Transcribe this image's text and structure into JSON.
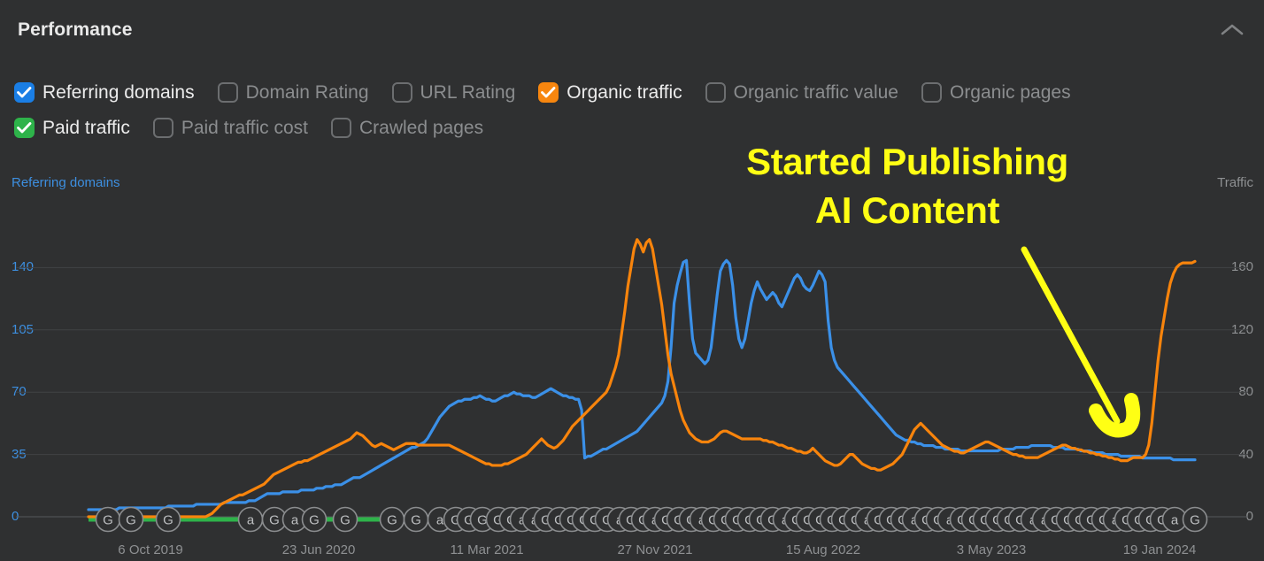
{
  "panel": {
    "title": "Performance",
    "collapse_icon": "chevron-up-icon"
  },
  "metrics": {
    "rows": [
      [
        {
          "label": "Referring domains",
          "checked": true,
          "color": "#1a7ee5"
        },
        {
          "label": "Domain Rating",
          "checked": false,
          "color": "#6c6e70"
        },
        {
          "label": "URL Rating",
          "checked": false,
          "color": "#6c6e70"
        },
        {
          "label": "Organic traffic",
          "checked": true,
          "color": "#f7860f"
        },
        {
          "label": "Organic traffic value",
          "checked": false,
          "color": "#6c6e70"
        },
        {
          "label": "Organic pages",
          "checked": false,
          "color": "#6c6e70"
        }
      ],
      [
        {
          "label": "Paid traffic",
          "checked": true,
          "color": "#2eb34a"
        },
        {
          "label": "Paid traffic cost",
          "checked": false,
          "color": "#6c6e70"
        },
        {
          "label": "Crawled pages",
          "checked": false,
          "color": "#6c6e70"
        }
      ]
    ]
  },
  "annotation": {
    "line1": "Started Publishing",
    "line2": "AI Content",
    "color": "#ffff14",
    "arrow_color": "#ffff14"
  },
  "chart_data": {
    "type": "line",
    "title": "Performance",
    "grid": true,
    "legend_position": "top",
    "xlabel": "",
    "x_ticks": [
      "6 Oct 2019",
      "23 Jun 2020",
      "11 Mar 2021",
      "27 Nov 2021",
      "15 Aug 2022",
      "3 May 2023",
      "19 Jan 2024"
    ],
    "axes": {
      "left": {
        "label": "Referring domains",
        "ticks": [
          140,
          105,
          70,
          35,
          0
        ],
        "range": [
          0,
          175
        ],
        "color": "#3d8fe0"
      },
      "right": {
        "label": "Traffic",
        "ticks": [
          160,
          120,
          80,
          40,
          0
        ],
        "range": [
          0,
          200
        ],
        "color": "#8e9092"
      }
    },
    "series": [
      {
        "name": "Referring domains",
        "color": "#3b90e8",
        "axis": "left",
        "values": [
          4,
          4,
          4,
          4,
          4,
          4,
          4,
          4,
          4,
          4,
          5,
          5,
          5,
          5,
          5,
          5,
          5,
          5,
          5,
          5,
          5,
          5,
          5,
          5,
          5,
          5,
          6,
          6,
          6,
          6,
          6,
          6,
          6,
          6,
          6,
          7,
          7,
          7,
          7,
          7,
          7,
          7,
          7,
          7,
          8,
          8,
          8,
          8,
          8,
          8,
          8,
          8,
          9,
          9,
          9,
          10,
          11,
          12,
          13,
          13,
          13,
          13,
          13,
          14,
          14,
          14,
          14,
          14,
          14,
          15,
          15,
          15,
          15,
          15,
          16,
          16,
          16,
          17,
          17,
          17,
          18,
          18,
          18,
          19,
          20,
          21,
          22,
          22,
          22,
          23,
          24,
          25,
          26,
          27,
          28,
          29,
          30,
          31,
          32,
          33,
          34,
          35,
          36,
          37,
          38,
          39,
          39,
          40,
          41,
          42,
          44,
          47,
          50,
          53,
          56,
          58,
          60,
          62,
          63,
          64,
          65,
          65,
          66,
          66,
          66,
          67,
          67,
          68,
          67,
          66,
          66,
          65,
          65,
          66,
          67,
          68,
          68,
          69,
          70,
          69,
          69,
          68,
          68,
          68,
          67,
          67,
          68,
          69,
          70,
          71,
          72,
          71,
          70,
          69,
          68,
          68,
          67,
          67,
          66,
          66,
          60,
          33,
          34,
          34,
          35,
          36,
          37,
          38,
          38,
          39,
          40,
          41,
          42,
          43,
          44,
          45,
          46,
          47,
          48,
          50,
          52,
          54,
          56,
          58,
          60,
          62,
          64,
          68,
          76,
          95,
          120,
          130,
          137,
          143,
          144,
          120,
          100,
          92,
          90,
          88,
          86,
          88,
          95,
          110,
          125,
          138,
          142,
          144,
          142,
          130,
          112,
          100,
          95,
          100,
          110,
          120,
          127,
          132,
          128,
          125,
          122,
          124,
          126,
          124,
          120,
          118,
          122,
          126,
          130,
          134,
          136,
          134,
          130,
          128,
          127,
          130,
          134,
          138,
          136,
          132,
          110,
          95,
          88,
          84,
          82,
          80,
          78,
          76,
          74,
          72,
          70,
          68,
          66,
          64,
          62,
          60,
          58,
          56,
          54,
          52,
          50,
          48,
          46,
          45,
          44,
          43,
          43,
          42,
          42,
          41,
          41,
          40,
          40,
          40,
          40,
          39,
          39,
          39,
          38,
          38,
          38,
          38,
          38,
          37,
          37,
          37,
          37,
          37,
          37,
          37,
          37,
          37,
          37,
          37,
          37,
          37,
          38,
          38,
          38,
          38,
          38,
          39,
          39,
          39,
          39,
          39,
          40,
          40,
          40,
          40,
          40,
          40,
          40,
          39,
          39,
          39,
          39,
          38,
          38,
          38,
          38,
          38,
          37,
          37,
          37,
          37,
          36,
          36,
          36,
          36,
          35,
          35,
          35,
          35,
          35,
          34,
          34,
          34,
          34,
          34,
          34,
          34,
          33,
          33,
          33,
          33,
          33,
          33,
          33,
          33,
          33,
          33,
          32,
          32,
          32,
          32,
          32,
          32,
          32,
          32
        ]
      },
      {
        "name": "Organic traffic",
        "color": "#f8840c",
        "axis": "right",
        "values": [
          0,
          0,
          0,
          0,
          0,
          0,
          0,
          0,
          0,
          0,
          0,
          0,
          0,
          0,
          0,
          0,
          0,
          0,
          0,
          0,
          0,
          0,
          0,
          0,
          0,
          0,
          0,
          0,
          0,
          0,
          0,
          0,
          0,
          0,
          0,
          0,
          0,
          0,
          0,
          1,
          2,
          4,
          6,
          8,
          9,
          10,
          11,
          12,
          13,
          14,
          14,
          15,
          16,
          17,
          18,
          19,
          20,
          21,
          23,
          25,
          27,
          28,
          29,
          30,
          31,
          32,
          33,
          34,
          35,
          35,
          36,
          36,
          37,
          38,
          39,
          40,
          41,
          42,
          43,
          44,
          45,
          46,
          47,
          48,
          49,
          50,
          52,
          54,
          53,
          52,
          50,
          48,
          46,
          45,
          46,
          47,
          46,
          45,
          44,
          43,
          44,
          45,
          46,
          47,
          47,
          47,
          47,
          46,
          46,
          46,
          46,
          46,
          46,
          46,
          46,
          46,
          46,
          46,
          45,
          44,
          43,
          42,
          41,
          40,
          39,
          38,
          37,
          36,
          35,
          34,
          34,
          33,
          33,
          33,
          33,
          34,
          34,
          35,
          36,
          37,
          38,
          39,
          40,
          42,
          44,
          46,
          48,
          50,
          48,
          46,
          45,
          44,
          45,
          47,
          49,
          52,
          55,
          58,
          60,
          62,
          64,
          66,
          68,
          70,
          72,
          74,
          76,
          78,
          80,
          84,
          90,
          96,
          104,
          118,
          132,
          148,
          160,
          172,
          178,
          175,
          170,
          176,
          178,
          172,
          160,
          148,
          136,
          120,
          104,
          92,
          84,
          76,
          68,
          62,
          58,
          54,
          52,
          50,
          49,
          48,
          48,
          48,
          49,
          50,
          52,
          54,
          55,
          55,
          54,
          53,
          52,
          51,
          50,
          50,
          50,
          50,
          50,
          50,
          50,
          49,
          49,
          48,
          48,
          47,
          46,
          46,
          45,
          44,
          44,
          43,
          42,
          42,
          41,
          41,
          42,
          44,
          42,
          40,
          38,
          36,
          35,
          34,
          33,
          33,
          34,
          36,
          38,
          40,
          40,
          38,
          36,
          34,
          33,
          32,
          31,
          31,
          30,
          30,
          31,
          32,
          33,
          34,
          36,
          38,
          40,
          44,
          48,
          52,
          56,
          58,
          60,
          58,
          56,
          54,
          52,
          50,
          48,
          46,
          45,
          44,
          43,
          42,
          42,
          41,
          41,
          42,
          43,
          44,
          45,
          46,
          47,
          48,
          48,
          47,
          46,
          45,
          44,
          43,
          42,
          41,
          40,
          40,
          39,
          39,
          38,
          38,
          38,
          38,
          38,
          39,
          40,
          41,
          42,
          43,
          44,
          45,
          46,
          46,
          45,
          44,
          44,
          43,
          43,
          42,
          42,
          41,
          41,
          40,
          40,
          39,
          39,
          38,
          38,
          37,
          37,
          36,
          36,
          36,
          37,
          38,
          38,
          38,
          38,
          40,
          46,
          60,
          80,
          100,
          116,
          128,
          140,
          150,
          156,
          160,
          162,
          163,
          163,
          163,
          163,
          164
        ]
      },
      {
        "name": "Paid traffic",
        "color": "#2eb34a",
        "axis": "right",
        "values": [
          0,
          0,
          0,
          0,
          0,
          0,
          0,
          0,
          0,
          0,
          0,
          0,
          0,
          0,
          0,
          0,
          0,
          0,
          0,
          0,
          0,
          0,
          0,
          0,
          0,
          0,
          0,
          0,
          0,
          0,
          0,
          0,
          0,
          0,
          0,
          0,
          0,
          0,
          0,
          0
        ]
      }
    ],
    "annotations": [
      {
        "text": "Started Publishing AI Content",
        "color": "#ffff14",
        "arrow_to_x_label": "3 May 2023"
      }
    ],
    "event_markers": {
      "google_label": "G",
      "ahrefs_label": "a",
      "positions_google": [
        122,
        148,
        190,
        283,
        310,
        333,
        355,
        390,
        443,
        470,
        497,
        515,
        530,
        545,
        563,
        578,
        590,
        604,
        617,
        632,
        646,
        660,
        672,
        686,
        700,
        713,
        727,
        740,
        753,
        767,
        781,
        793,
        806,
        820,
        833,
        847,
        860,
        873,
        887,
        900,
        913,
        927,
        940,
        953,
        967,
        980,
        993,
        1007,
        1020,
        1033,
        1047,
        1060,
        1073,
        1087,
        1100,
        1113,
        1127,
        1140,
        1153,
        1167,
        1180,
        1193,
        1207,
        1220,
        1233,
        1247,
        1260,
        1273,
        1287,
        1300,
        1313,
        1327,
        1350
      ]
    }
  }
}
